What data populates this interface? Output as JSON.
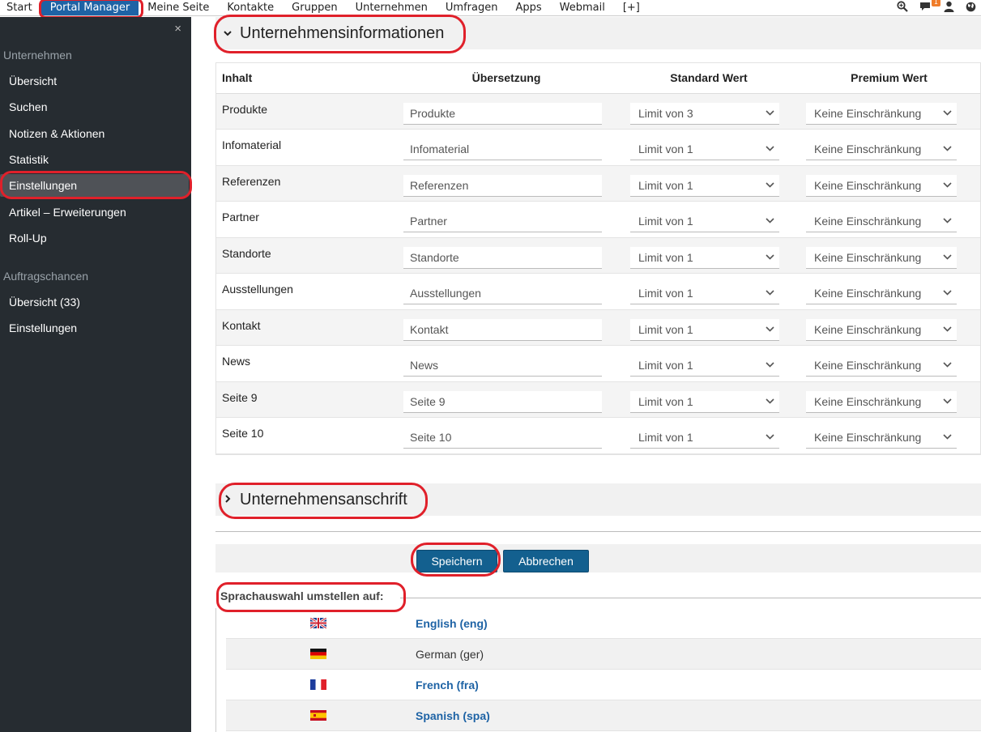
{
  "topnav": {
    "items": [
      "Start",
      "Portal Manager",
      "Meine Seite",
      "Kontakte",
      "Gruppen",
      "Unternehmen",
      "Umfragen",
      "Apps",
      "Webmail",
      "[+]"
    ],
    "active_index": 1,
    "notification_count": "1"
  },
  "sidebar": {
    "close_label": "×",
    "group1": "Unternehmen",
    "group1_items": [
      "Übersicht",
      "Suchen",
      "Notizen & Aktionen",
      "Statistik",
      "Einstellungen",
      "Artikel – Erweiterungen",
      "Roll-Up"
    ],
    "group1_active_index": 4,
    "group2": "Auftragschancen",
    "group2_items": [
      "Übersicht (33)",
      "Einstellungen"
    ]
  },
  "section1": {
    "title": "Unternehmensinformationen",
    "columns": [
      "Inhalt",
      "Übersetzung",
      "Standard Wert",
      "Premium Wert"
    ],
    "rows": [
      {
        "label": "Produkte",
        "translation": "Produkte",
        "standard": "Limit von 3",
        "premium": "Keine Einschränkung"
      },
      {
        "label": "Infomaterial",
        "translation": "Infomaterial",
        "standard": "Limit von 1",
        "premium": "Keine Einschränkung"
      },
      {
        "label": "Referenzen",
        "translation": "Referenzen",
        "standard": "Limit von 1",
        "premium": "Keine Einschränkung"
      },
      {
        "label": "Partner",
        "translation": "Partner",
        "standard": "Limit von 1",
        "premium": "Keine Einschränkung"
      },
      {
        "label": "Standorte",
        "translation": "Standorte",
        "standard": "Limit von 1",
        "premium": "Keine Einschränkung"
      },
      {
        "label": "Ausstellungen",
        "translation": "Ausstellungen",
        "standard": "Limit von 1",
        "premium": "Keine Einschränkung"
      },
      {
        "label": "Kontakt",
        "translation": "Kontakt",
        "standard": "Limit von 1",
        "premium": "Keine Einschränkung"
      },
      {
        "label": "News",
        "translation": "News",
        "standard": "Limit von 1",
        "premium": "Keine Einschränkung"
      },
      {
        "label": "Seite 9",
        "translation": "Seite 9",
        "standard": "Limit von 1",
        "premium": "Keine Einschränkung"
      },
      {
        "label": "Seite 10",
        "translation": "Seite 10",
        "standard": "Limit von 1",
        "premium": "Keine Einschränkung"
      }
    ]
  },
  "section2": {
    "title": "Unternehmensanschrift"
  },
  "buttons": {
    "save": "Speichern",
    "cancel": "Abbrechen"
  },
  "language": {
    "title": "Sprachauswahl umstellen auf:",
    "options": [
      {
        "label": "English (eng)",
        "flag": "uk-flag-icon",
        "current": false
      },
      {
        "label": "German (ger)",
        "flag": "germany-flag-icon",
        "current": true
      },
      {
        "label": "French (fra)",
        "flag": "france-flag-icon",
        "current": false
      },
      {
        "label": "Spanish (spa)",
        "flag": "spain-flag-icon",
        "current": false
      }
    ]
  },
  "colors": {
    "accent": "#1e63a5",
    "button": "#13608f",
    "sidebar": "#262c31",
    "annotation": "#e0202a"
  }
}
